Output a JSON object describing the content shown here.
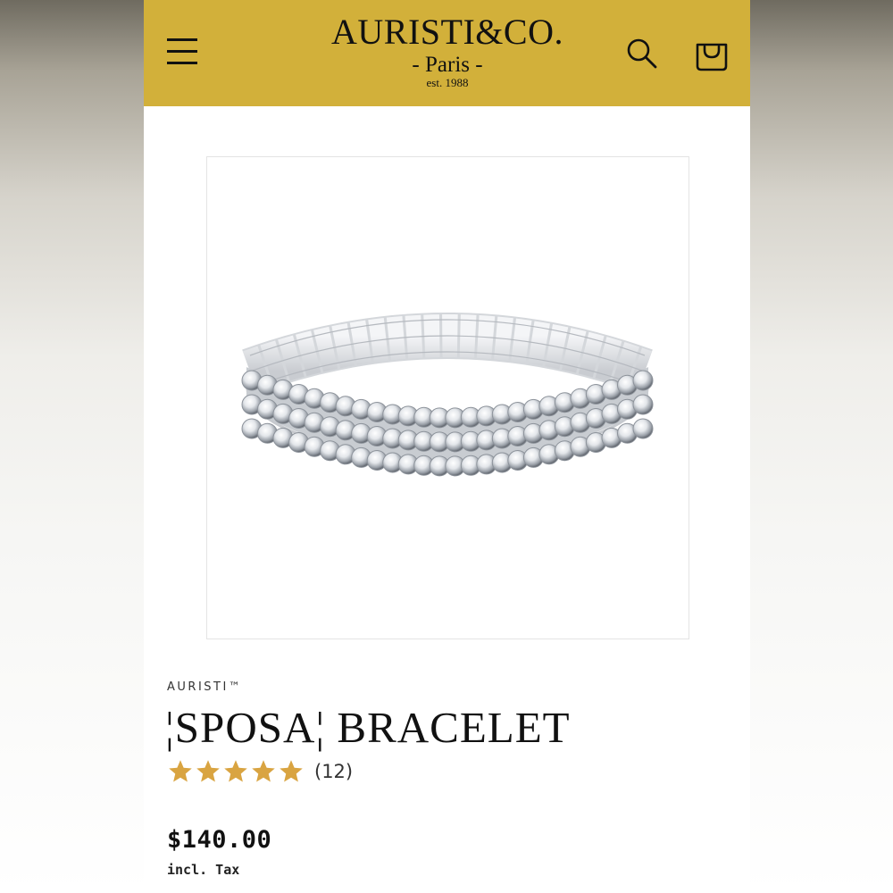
{
  "header": {
    "logo": {
      "name": "AURISTI&CO.",
      "city": "- Paris -",
      "established": "est. 1988"
    },
    "icons": {
      "menu": "menu-icon",
      "search": "search-icon",
      "cart": "cart-icon"
    },
    "background_color": "#d2b03a"
  },
  "product": {
    "image": "bracelet-image",
    "brand": "AURISTI™",
    "title": "¦SPOSA¦ BRACELET",
    "rating": {
      "stars": 5,
      "max": 5,
      "count": "(12)",
      "star_color": "#d9a441"
    },
    "price": "$140.00",
    "tax_note": "incl. Tax"
  }
}
